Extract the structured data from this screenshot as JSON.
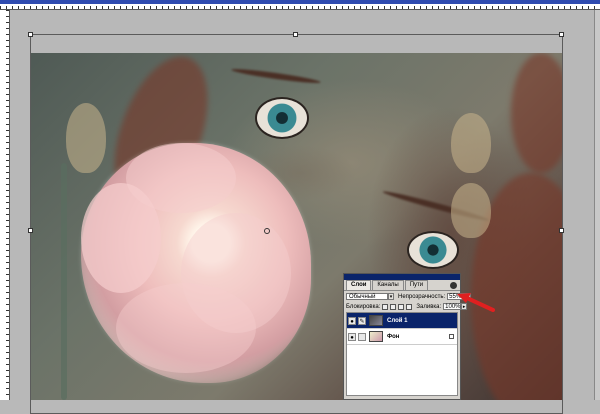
{
  "layers_panel": {
    "tabs": [
      {
        "label": "Слои"
      },
      {
        "label": "Каналы"
      },
      {
        "label": "Пути"
      }
    ],
    "blend_mode": "Обычный",
    "opacity_label": "Непрозрачность:",
    "opacity_value": "55%",
    "lock_label": "Блокировка:",
    "fill_label": "Заливка:",
    "fill_value": "100%",
    "layers": [
      {
        "name": "Слой 1",
        "selected": true
      },
      {
        "name": "Фон",
        "selected": false
      }
    ]
  },
  "colors": {
    "selection": "#0a246a",
    "panel_bg": "#d6d3ce",
    "arrow": "#e02020"
  },
  "icons": [
    "eye-icon",
    "brush-icon",
    "lock-icon",
    "panel-menu-icon",
    "arrow-annotation-icon"
  ]
}
